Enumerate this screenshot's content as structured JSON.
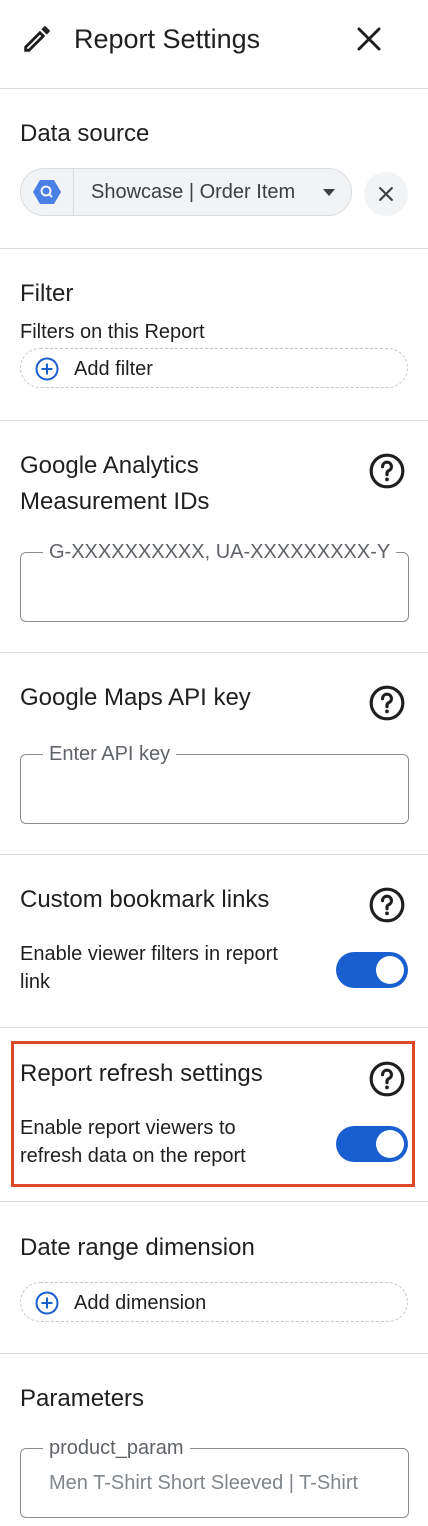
{
  "header": {
    "title": "Report Settings"
  },
  "data_source": {
    "heading": "Data source",
    "selected": "Showcase | Order Item"
  },
  "filter": {
    "heading": "Filter",
    "subtitle": "Filters on this Report",
    "add_label": "Add filter"
  },
  "analytics": {
    "heading_line1": "Google Analytics",
    "heading_line2": "Measurement IDs",
    "placeholder": "G-XXXXXXXXXX, UA-XXXXXXXXX-Y",
    "value": ""
  },
  "maps": {
    "heading": "Google Maps API key",
    "placeholder": "Enter API key",
    "value": ""
  },
  "bookmark": {
    "heading": "Custom bookmark links",
    "line1": "Enable viewer filters in report",
    "line2": "link",
    "enabled": true
  },
  "refresh": {
    "heading": "Report refresh settings",
    "line1": "Enable report viewers to",
    "line2": "refresh data on the report",
    "enabled": true,
    "highlight_color": "#e0482a"
  },
  "date_range": {
    "heading": "Date range dimension",
    "add_label": "Add dimension"
  },
  "parameters": {
    "heading": "Parameters",
    "param_name": "product_param",
    "param_value": "Men T-Shirt Short Sleeved | T-Shirt"
  },
  "colors": {
    "accent": "#1a5fd0",
    "divider": "#dadce0",
    "text": "#1f1f1f",
    "muted": "#80868b"
  },
  "icons": [
    "edit-icon",
    "close-icon",
    "bigquery-icon",
    "help-icon",
    "add-circle-icon",
    "chevron-down-icon"
  ]
}
